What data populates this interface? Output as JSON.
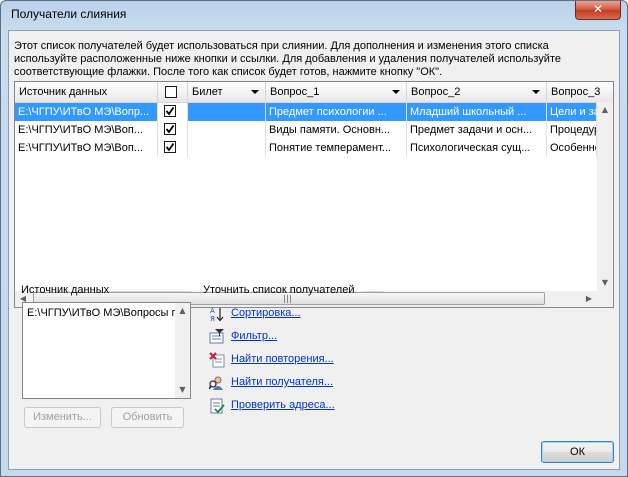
{
  "window": {
    "title": "Получатели слияния",
    "close_glyph": "✕"
  },
  "description": "Этот список получателей будет использоваться при слиянии. Для дополнения и изменения этого списка используйте расположенные ниже кнопки и ссылки. Для добавления и удаления получателей используйте соответствующие флажки. После того как список будет готов, нажмите кнопку \"ОК\".",
  "grid": {
    "columns": [
      "Источник данных",
      "",
      "Билет",
      "Вопрос_1",
      "Вопрос_2",
      "Вопрос_3"
    ],
    "rows": [
      {
        "source": "E:\\ЧГПУ\\ИТвО МЭ\\Вопр...",
        "checked": true,
        "bilet": "",
        "q1": "Предмет психологии ...",
        "q2": "Младший школьный ...",
        "q3": "Цели и зада"
      },
      {
        "source": "E:\\ЧГПУ\\ИТвО МЭ\\Воп...",
        "checked": true,
        "bilet": "",
        "q1": "Виды памяти. Основн...",
        "q2": "Предмет задачи и осн...",
        "q3": "Процедуры"
      },
      {
        "source": "E:\\ЧГПУ\\ИТвО МЭ\\Воп...",
        "checked": true,
        "bilet": "",
        "q1": "Понятие темперамент...",
        "q2": "Психологическая сущ...",
        "q3": "Особенност"
      }
    ],
    "selected_row": 0
  },
  "datasource": {
    "label": "Источник данных",
    "items": [
      "E:\\ЧГПУ\\ИТвО МЭ\\Вопросы п"
    ],
    "edit_label": "Изменить...",
    "refresh_label": "Обновить"
  },
  "refine": {
    "label": "Уточнить список получателей",
    "links": [
      {
        "label": "Сортировка...",
        "icon": "sort-icon"
      },
      {
        "label": "Фильтр...",
        "icon": "filter-icon"
      },
      {
        "label": "Найти повторения...",
        "icon": "find-duplicates-icon"
      },
      {
        "label": "Найти получателя...",
        "icon": "find-recipient-icon"
      },
      {
        "label": "Проверить адреса...",
        "icon": "validate-addresses-icon"
      }
    ]
  },
  "ok_label": "ОК"
}
